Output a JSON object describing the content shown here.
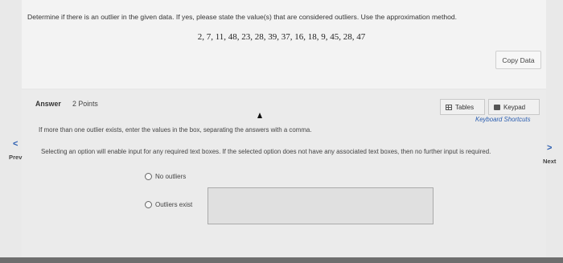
{
  "question": {
    "prompt": "Determine if there is an outlier in the given data. If yes, please state the value(s) that are considered outliers. Use the approximation method.",
    "data": "2, 7, 11, 48, 23, 28, 39, 37, 16, 18, 9, 45, 28, 47",
    "copy_label": "Copy Data"
  },
  "answer": {
    "label": "Answer",
    "points": "2 Points",
    "tables_label": "Tables",
    "keypad_label": "Keypad",
    "shortcuts_label": "Keyboard Shortcuts",
    "instruction_multiple": "If more than one outlier exists, enter the values in the box, separating the answers with a comma.",
    "instruction_select": "Selecting an option will enable input for any required text boxes. If the selected option does not have any associated text boxes, then no further input is required.",
    "option_no_outliers": "No outliers",
    "option_outliers_exist": "Outliers exist",
    "outliers_value": ""
  },
  "nav": {
    "prev_label": "Prev",
    "next_label": "Next",
    "prev_icon": "chevron-left-icon",
    "next_icon": "chevron-right-icon"
  },
  "colors": {
    "link": "#2a5db0",
    "background": "#e9e9e9"
  }
}
